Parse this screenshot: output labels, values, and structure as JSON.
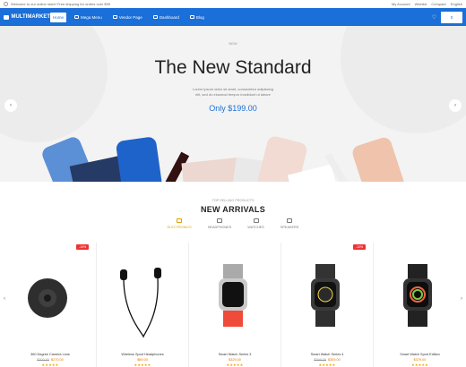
{
  "topbar": {
    "message": "Welcome to our online store! Free shipping for orders over $99",
    "right_items": [
      "My Account",
      "Wishlist",
      "Compare",
      "English"
    ]
  },
  "navbar": {
    "logo": "MULTIMARKET",
    "items": [
      {
        "label": "Home"
      },
      {
        "label": "Mega Menu"
      },
      {
        "label": "Vendor Page"
      },
      {
        "label": "Dashboard"
      },
      {
        "label": "Blog"
      }
    ],
    "cart_label": "0"
  },
  "hero": {
    "small_label": "NEW",
    "title": "The New Standard",
    "subtitle_line1": "Lorem ipsum dolor sit amet, consectetur adipiscing",
    "subtitle_line2": "elit, sed do eiusmod tempor incididunt ut labore",
    "price": "Only $199.00"
  },
  "section": {
    "small": "TOP SELLING PRODUCTS",
    "title": "NEW ARRIVALS",
    "tabs": [
      {
        "label": "ELECTRONICS"
      },
      {
        "label": "HEADPHONES"
      },
      {
        "label": "WATCHES"
      },
      {
        "label": "SPEAKERS"
      }
    ]
  },
  "products": [
    {
      "name": "360 Degree Camera Lens",
      "old_price": "$300.00",
      "price": "$270.00",
      "badge": "-10%",
      "stars": "★★★★★"
    },
    {
      "name": "Wireless Sport Headphones",
      "old_price": "",
      "price": "$89.00",
      "badge": "",
      "stars": "★★★★★"
    },
    {
      "name": "Smart Watch Series 3",
      "old_price": "",
      "price": "$329.00",
      "badge": "",
      "stars": "★★★★★"
    },
    {
      "name": "Smart Watch Series 4",
      "old_price": "$399.00",
      "price": "$359.00",
      "badge": "-10%",
      "stars": "★★★★★"
    },
    {
      "name": "Smart Watch Sport Edition",
      "old_price": "",
      "price": "$379.00",
      "badge": "",
      "stars": "★★★★★"
    }
  ],
  "colors": {
    "accent": "#1a6fd8",
    "highlight": "#e0a100",
    "sale": "#e33333"
  }
}
